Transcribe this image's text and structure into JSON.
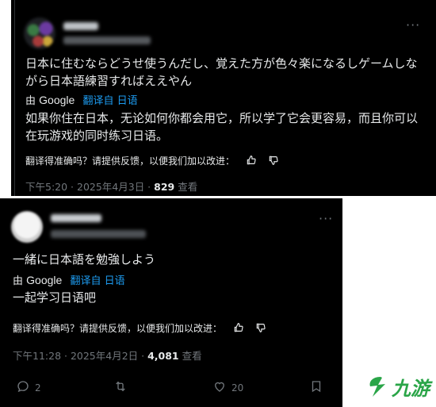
{
  "tweets": [
    {
      "original_text": "日本に住むならどうせ使うんだし、覚えた方が色々楽になるしゲームしながら日本語練習すればええやん",
      "by_label": "由",
      "google_label": "Google",
      "translated_label": "翻译自 日语",
      "translated_text": "如果你住在日本，无论如何你都会用它，所以学了它会更容易，而且你可以在玩游戏的同时练习日语。",
      "feedback_prompt": "翻译得准确吗？请提供反馈，以便我们加以改进：",
      "timestamp": "下午5:20 · 2025年4月3日 ·",
      "views_count": "829",
      "views_label": "查看"
    },
    {
      "original_text": "一緒に日本語を勉強しよう",
      "by_label": "由",
      "google_label": "Google",
      "translated_label": "翻译自 日语",
      "translated_text": "一起学习日语吧",
      "feedback_prompt": "翻译得准确吗？请提供反馈，以便我们加以改进：",
      "timestamp": "下午11:28 · 2025年4月2日 ·",
      "views_count": "4,081",
      "views_label": "查看",
      "actions": {
        "reply_count": "2",
        "like_count": "20"
      }
    }
  ],
  "icons": {
    "more": "more-horizontal-icon",
    "thumbs_up": "thumbs-up-icon",
    "thumbs_down": "thumbs-down-icon",
    "reply": "reply-icon",
    "retweet": "retweet-icon",
    "like": "heart-icon",
    "bookmark": "bookmark-icon"
  },
  "watermark": {
    "text": "九游",
    "color": "#2aa548"
  }
}
